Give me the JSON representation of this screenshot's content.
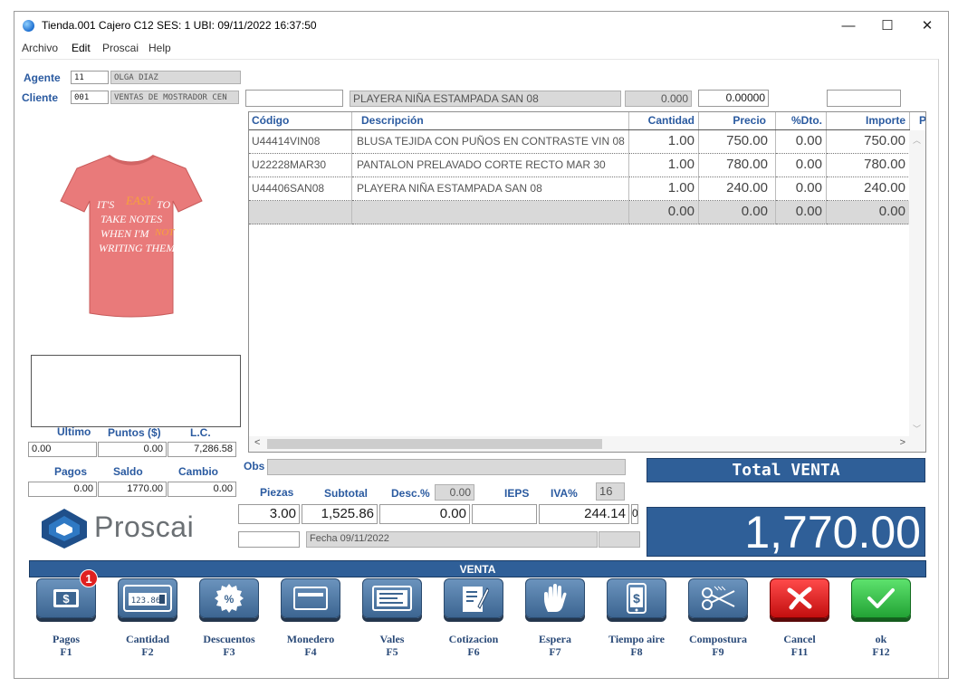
{
  "titlebar": {
    "title": "Tienda.001  Cajero C12    SES: 1   UBI:    09/11/2022 16:37:50",
    "minimize": "—",
    "maximize": "☐",
    "close": "✕"
  },
  "menu": [
    "Archivo",
    "Edit",
    "Proscai",
    "Help"
  ],
  "agente": {
    "label": "Agente",
    "code": "11",
    "name": "OLGA DIAZ"
  },
  "cliente": {
    "label": "Cliente",
    "code": "001",
    "name": "VENTAS DE MOSTRADOR CEN"
  },
  "entry": {
    "code": "",
    "description": "PLAYERA NIÑA ESTAMPADA SAN 08",
    "quantity": "0.000",
    "price": "0.00000",
    "extra": ""
  },
  "grid": {
    "headers": [
      "Código",
      "Descripción",
      "Cantidad",
      "Precio",
      "%Dto.",
      "Importe",
      "P"
    ],
    "rows": [
      [
        "U44414VIN08",
        "BLUSA TEJIDA CON PUÑOS EN CONTRASTE VIN 08",
        "1.00",
        "750.00",
        "0.00",
        "750.00"
      ],
      [
        "U22228MAR30",
        "PANTALON PRELAVADO CORTE RECTO MAR 30",
        "1.00",
        "780.00",
        "0.00",
        "780.00"
      ],
      [
        "U44406SAN08",
        "PLAYERA NIÑA ESTAMPADA SAN 08",
        "1.00",
        "240.00",
        "0.00",
        "240.00"
      ],
      [
        "",
        "",
        "0.00",
        "0.00",
        "0.00",
        "0.00"
      ]
    ]
  },
  "shirt_text": [
    "IT'S",
    "EASY",
    "TO",
    "TAKE NOTES",
    "WHEN I'M",
    "NOT",
    "WRITING THEM"
  ],
  "left_summary": {
    "ultimo_label": "Ultimo",
    "puntos_label": "Puntos ($)",
    "lc_label": "L.C.",
    "ultimo": "0.00",
    "puntos": "0.00",
    "lc": "7,286.58",
    "pagos_label": "Pagos",
    "saldo_label": "Saldo",
    "cambio_label": "Cambio",
    "pagos": "0.00",
    "saldo": "1770.00",
    "cambio": "0.00"
  },
  "obs": {
    "label": "Obs",
    "value": ""
  },
  "totals": {
    "piezas_label": "Piezas",
    "subtotal_label": "Subtotal",
    "desc_label": "Desc.%",
    "desc_pct": "0.00",
    "ieps_label": "IEPS",
    "iva_label": "IVA%",
    "iva_pct": "16",
    "piezas": "3.00",
    "subtotal": "1,525.86",
    "descuento": "0.00",
    "ieps": "",
    "iva": "244.14",
    "iva_extra": "0",
    "fecha": "Fecha 09/11/2022"
  },
  "logo": "Proscai",
  "total_venta_label": "Total VENTA",
  "total_venta": "1,770.00",
  "venta_bar": "VENTA",
  "buttons": [
    {
      "name": "Pagos",
      "key": "F1",
      "badge": "1",
      "icon": "dollar-bill-icon"
    },
    {
      "name": "Cantidad",
      "key": "F2",
      "icon": "calculator-icon",
      "display": "123.86"
    },
    {
      "name": "Descuentos",
      "key": "F3",
      "icon": "percent-icon"
    },
    {
      "name": "Monedero",
      "key": "F4",
      "icon": "wallet-card-icon"
    },
    {
      "name": "Vales",
      "key": "F5",
      "icon": "voucher-icon"
    },
    {
      "name": "Cotizacion",
      "key": "F6",
      "icon": "quote-icon"
    },
    {
      "name": "Espera",
      "key": "F7",
      "icon": "hand-icon"
    },
    {
      "name": "Tiempo aire",
      "key": "F8",
      "icon": "phone-credit-icon"
    },
    {
      "name": "Compostura",
      "key": "F9",
      "icon": "scissors-icon"
    },
    {
      "name": "Cancel",
      "key": "F11",
      "icon": "cancel-x-icon"
    },
    {
      "name": "ok",
      "key": "F12",
      "icon": "check-icon"
    }
  ],
  "colors": {
    "accent": "#2f5f98",
    "label": "#2a5aa0",
    "cancel": "#e02020",
    "ok": "#2db83f",
    "shirt": "#e97a7a"
  }
}
